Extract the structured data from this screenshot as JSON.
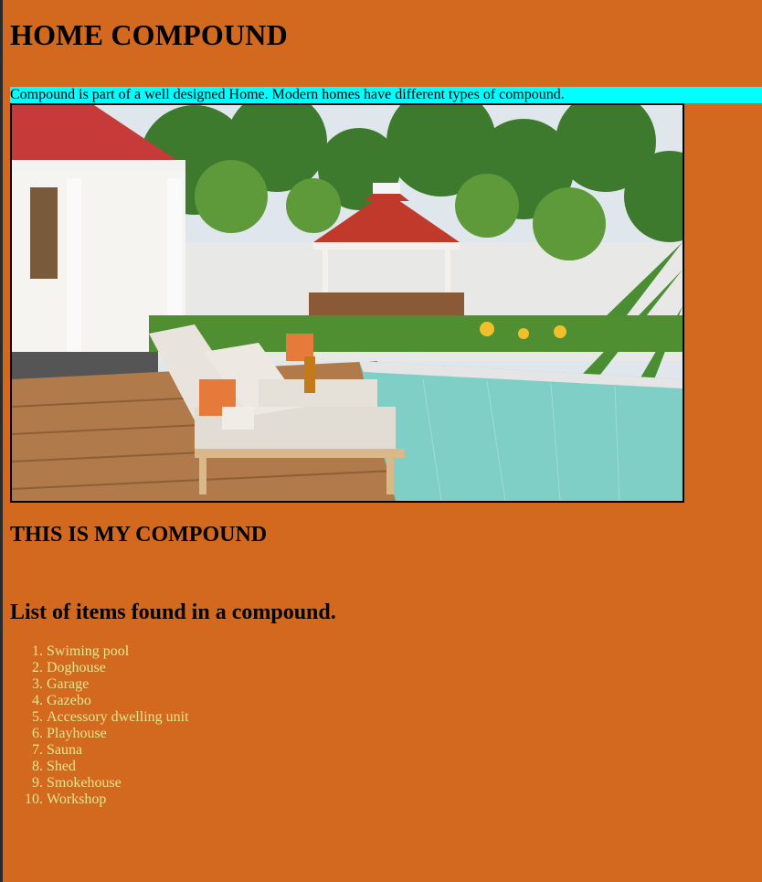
{
  "page": {
    "title": "HOME COMPOUND",
    "intro": "Compound is part of a well designed Home. Modern homes have different types of compound.",
    "subtitle": "THIS IS MY COMPOUND",
    "list_heading": "List of items found in a compound."
  },
  "image": {
    "alt": "Backyard compound with swimming pool, lounge chairs, gazebo and garden"
  },
  "items": [
    "Swiming pool",
    "Doghouse",
    "Garage",
    "Gazebo",
    "Accessory dwelling unit",
    "Playhouse",
    "Sauna",
    "Shed",
    "Smokehouse",
    "Workshop"
  ],
  "colors": {
    "background": "#d2691e",
    "intro_highlight": "#00ffff",
    "list_text": "#e5e58f"
  }
}
